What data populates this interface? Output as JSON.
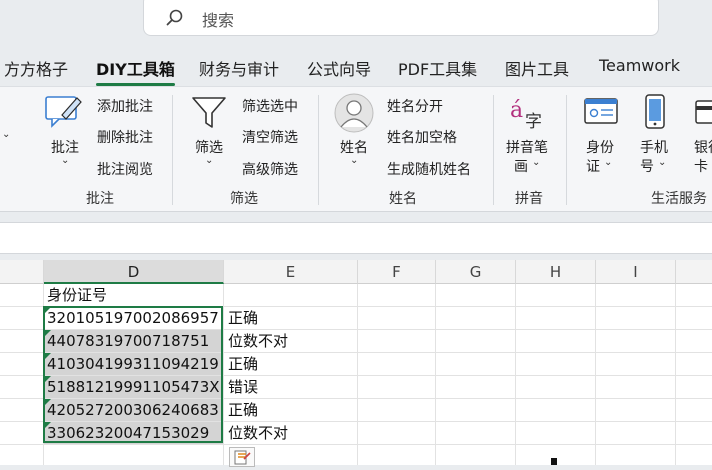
{
  "search": {
    "placeholder": "搜索"
  },
  "tabs": [
    {
      "label": "方方格子"
    },
    {
      "label": "DIY工具箱",
      "active": true
    },
    {
      "label": "财务与审计"
    },
    {
      "label": "公式向导"
    },
    {
      "label": "PDF工具集"
    },
    {
      "label": "图片工具"
    },
    {
      "label": "Teamwork"
    }
  ],
  "ribbon": {
    "annotate": {
      "big_label": "批注",
      "items": [
        "添加批注",
        "删除批注",
        "批注阅览"
      ],
      "group_label": "批注"
    },
    "filter": {
      "big_label": "筛选",
      "items": [
        "筛选选中",
        "清空筛选",
        "高级筛选"
      ],
      "group_label": "筛选"
    },
    "name": {
      "big_label": "姓名",
      "items": [
        "姓名分开",
        "姓名加空格",
        "生成随机姓名"
      ],
      "group_label": "姓名"
    },
    "pinyin": {
      "big_label_1": "拼音笔",
      "big_label_2": "画",
      "group_label": "拼音"
    },
    "life": {
      "idcard_1": "身份",
      "idcard_2": "证",
      "phone_1": "手机",
      "phone_2": "号",
      "bank_1": "银行",
      "bank_2": "卡",
      "group_label": "生活服务"
    }
  },
  "sheet": {
    "columns": [
      "D",
      "E",
      "F",
      "G",
      "H",
      "I"
    ],
    "header_cell": "身份证号",
    "rows": [
      {
        "id": "320105197002086957",
        "result": "正确"
      },
      {
        "id": "44078319700718751",
        "result": "位数不对"
      },
      {
        "id": "410304199311094219",
        "result": "正确"
      },
      {
        "id": "51881219991105473X",
        "result": "错误"
      },
      {
        "id": "420527200306240683",
        "result": "正确"
      },
      {
        "id": "33062320047153029",
        "result": "位数不对"
      }
    ]
  },
  "colors": {
    "accent": "#1e7b45",
    "selection_fill": "#d4d4d4"
  }
}
